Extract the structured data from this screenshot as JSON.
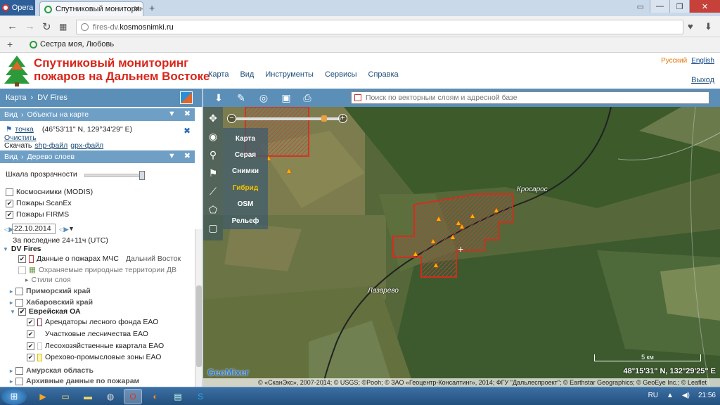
{
  "browser": {
    "menu_label": "Opera",
    "tab_title": "Спутниковый мониторинг",
    "url_prefix": "fires-dv.",
    "url_domain": "kosmosnimki.ru",
    "bookmark": "Сестра моя, Любовь"
  },
  "site": {
    "brand_line1": "Спутниковый мониторинг",
    "brand_line2": "пожаров на Дальнем Востоке",
    "lang_ru": "Русский",
    "lang_en": "English",
    "menu": [
      "Карта",
      "Вид",
      "Инструменты",
      "Сервисы",
      "Справка"
    ],
    "exit": "Выход"
  },
  "panel": {
    "breadcrumb_root": "Карта",
    "breadcrumb_current": "DV Fires",
    "objects_section": {
      "view": "Вид",
      "title": "Объекты на карте"
    },
    "point_label": "точка",
    "point_coords": "(46°53'11\" N, 129°34'29\" E)",
    "clear": "Очистить",
    "download_prefix": "Скачать",
    "download_shp": "shp-файл",
    "download_gpx": "gpx-файл",
    "tree_section": {
      "view": "Вид",
      "title": "Дерево слоев"
    },
    "opacity_label": "Шкала прозрачности",
    "layers_top": [
      {
        "label": "Космоснимки (MODIS)",
        "checked": false
      },
      {
        "label": "Пожары ScanEx",
        "checked": true
      },
      {
        "label": "Пожары FIRMS",
        "checked": true
      }
    ],
    "date": "22.10.2014",
    "period": "За последние 24+11ч (UTC)",
    "tree_root": "DV Fires",
    "tree": {
      "mchs": "Данные о пожарах МЧС",
      "mchs_region": "Дальний Восток",
      "protected": "Охраняемые природные территории ДВ",
      "styles": "Стили слоя",
      "primorsky": "Приморский край",
      "khabarovsk": "Хабаровский край",
      "jewish": "Еврейская ОА",
      "jewish_children": [
        "Арендаторы лесного фонда ЕАО",
        "Участковые лесничества ЕАО",
        "Лесохозяйственные квартала ЕАО",
        "Орехово-промысловые зоны ЕАО"
      ],
      "amur": "Амурская область",
      "archive": "Архивные данные по пожарам"
    }
  },
  "map": {
    "search_placeholder": "Поиск по векторным слоям и адресной базе",
    "base_layers": [
      "Карта",
      "Серая",
      "Снимки",
      "Гибрид",
      "OSM",
      "Рельеф"
    ],
    "active_layer": "Гибрид",
    "places": [
      "Кросарос",
      "Лазарево"
    ],
    "scale": "5 км",
    "coords": "48°15'31\" N, 132°29'25\" E",
    "geomixer": "GeoMixer",
    "attribution": "© «СканЭкс», 2007-2014; © USGS; ©Pooh; © ЗАО «Геоцентр-Консалтинг», 2014; ФГУ \"Дальлеспроект\"; © Earthstar Geographics; © GeoEye Inc.; © Leaflet"
  },
  "taskbar": {
    "lang": "RU",
    "time": "21:56"
  },
  "colors": {
    "brand_red": "#d8251a",
    "panel_blue": "#5b8fb8",
    "fire_outline": "#e0281c"
  }
}
